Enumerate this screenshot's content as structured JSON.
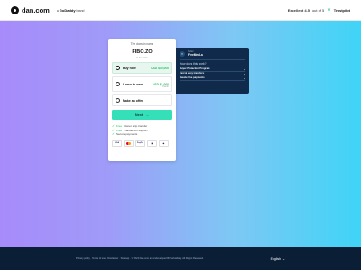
{
  "header": {
    "brand": "dan.com",
    "by": "a",
    "partner": "GoDaddy",
    "partner_suffix": "brand",
    "rating_label": "Excellent 4.5",
    "rating_outof": "out of 5",
    "trustpilot": "Trustpilot"
  },
  "card": {
    "label": "The domain name",
    "domain": "FIBO.ZO",
    "status": "is for sale",
    "options": [
      {
        "label": "Buy now",
        "price": "USD $30,000",
        "sub": ""
      },
      {
        "label": "Lease to own",
        "price": "USD $1,000",
        "sub": "/month"
      },
      {
        "label": "Make an offer",
        "price": "",
        "sub": ""
      }
    ],
    "button": "Next",
    "features": [
      {
        "highlight": "Free",
        "text": "Owner ship transfer"
      },
      {
        "highlight": "Free",
        "text": "Transaction support"
      },
      {
        "highlight": "",
        "text": "Secure payments"
      }
    ],
    "payments": [
      "VISA",
      "",
      "PayPal",
      "",
      ""
    ]
  },
  "panel": {
    "seller_label": "Seller",
    "seller_name": "FreeMedLa",
    "how_title": "How does this work?",
    "rows": [
      "Buyer Protection Program",
      "Fast & easy transfers",
      "Hassle free payments"
    ]
  },
  "footer": {
    "links": "Privacy policy  ·  Terms of use  ·  Disclaimer  ·  Sitemap  ·  © 2024 Dan.com an Undeveloped BV subsidiary. All Rights Reserved.",
    "language": "English"
  },
  "colors": {
    "accent": "#35e0b8",
    "price": "#22c55e",
    "panel": "#0f2a4a",
    "footer": "#0a1f36"
  }
}
